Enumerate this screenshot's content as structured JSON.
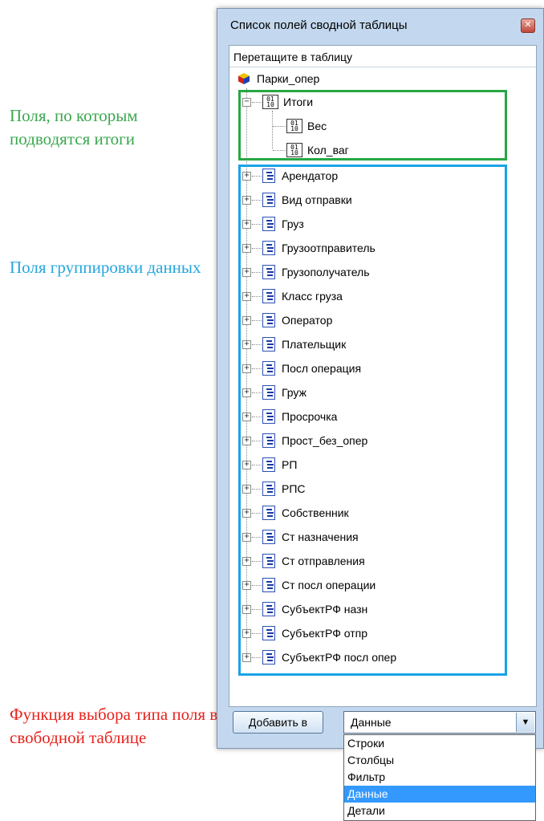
{
  "annotations": {
    "totals_fields": "Поля, по которым подводятся итоги",
    "grouping_fields": "Поля группировки данных",
    "field_type_function": "Функция выбора типа поля в свободной таблице"
  },
  "window": {
    "title": "Список полей сводной таблицы",
    "close_symbol": "✕",
    "drag_hint": "Перетащите в таблицу"
  },
  "tree": {
    "root": "Парки_опер",
    "totals_group": {
      "label": "Итоги",
      "expander": "−",
      "measures": [
        "Вес",
        "Кол_ваг"
      ]
    },
    "dimensions": [
      "Арендатор",
      "Вид отправки",
      "Груз",
      "Грузоотправитель",
      "Грузополучатель",
      "Класс груза",
      "Оператор",
      "Плательщик",
      "Посл операция",
      "Груж",
      "Просрочка",
      "Прост_без_опер",
      "РП",
      "РПС",
      "Собственник",
      "Ст назначения",
      "Ст отправления",
      "Ст посл операции",
      "СубъектРФ назн",
      "СубъектРФ отпр",
      "СубъектРФ посл опер"
    ],
    "expander_symbol": "+"
  },
  "controls": {
    "add_button": "Добавить в",
    "select_value": "Данные",
    "select_arrow": "▼",
    "options": [
      "Строки",
      "Столбцы",
      "Фильтр",
      "Данные",
      "Детали"
    ],
    "selected_option": "Данные"
  },
  "colors": {
    "green": "#28a745",
    "blue": "#1aa3e8",
    "red": "#e8231d",
    "selection": "#3399ff"
  }
}
